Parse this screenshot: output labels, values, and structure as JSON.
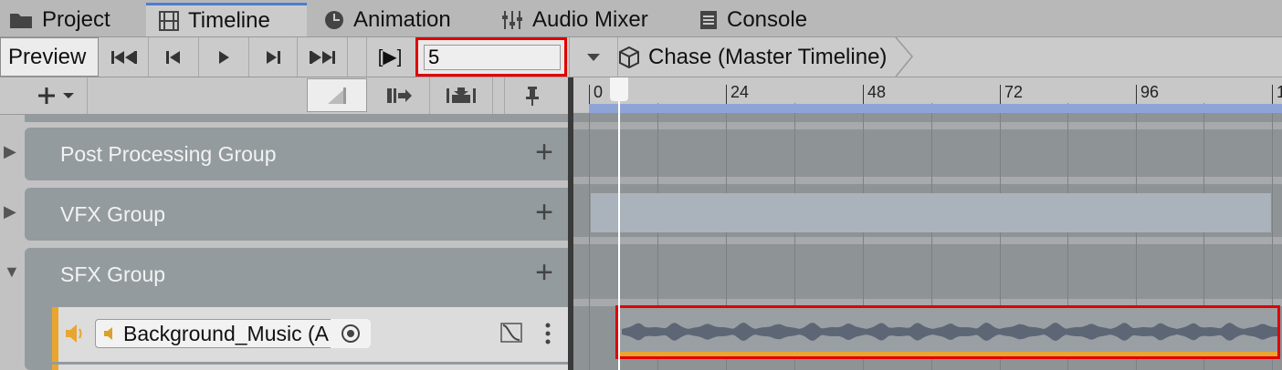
{
  "tabs": [
    {
      "label": "Project",
      "icon": "folder-icon"
    },
    {
      "label": "Timeline",
      "icon": "film-icon",
      "active": true
    },
    {
      "label": "Animation",
      "icon": "clock-icon"
    },
    {
      "label": "Audio Mixer",
      "icon": "mixer-icon"
    },
    {
      "label": "Console",
      "icon": "console-icon"
    }
  ],
  "toolbar": {
    "preview_label": "Preview",
    "frame_value": "5",
    "frame_prefix": "[▶]",
    "breadcrumb": "Chase (Master Timeline)"
  },
  "ruler": {
    "labels": [
      "0",
      "24",
      "48",
      "72",
      "96",
      "1"
    ]
  },
  "tracks": {
    "groups": [
      {
        "label": "Post Processing Group",
        "collapsed": true
      },
      {
        "label": "VFX Group",
        "collapsed": true
      },
      {
        "label": "SFX Group",
        "collapsed": false
      }
    ],
    "audio_track_name": "Background_Music (A"
  },
  "colors": {
    "accent_blue": "#4a7fd0",
    "highlight_red": "#e00000",
    "audio_orange": "#e8a630",
    "range_blue": "#8ea4d6"
  }
}
